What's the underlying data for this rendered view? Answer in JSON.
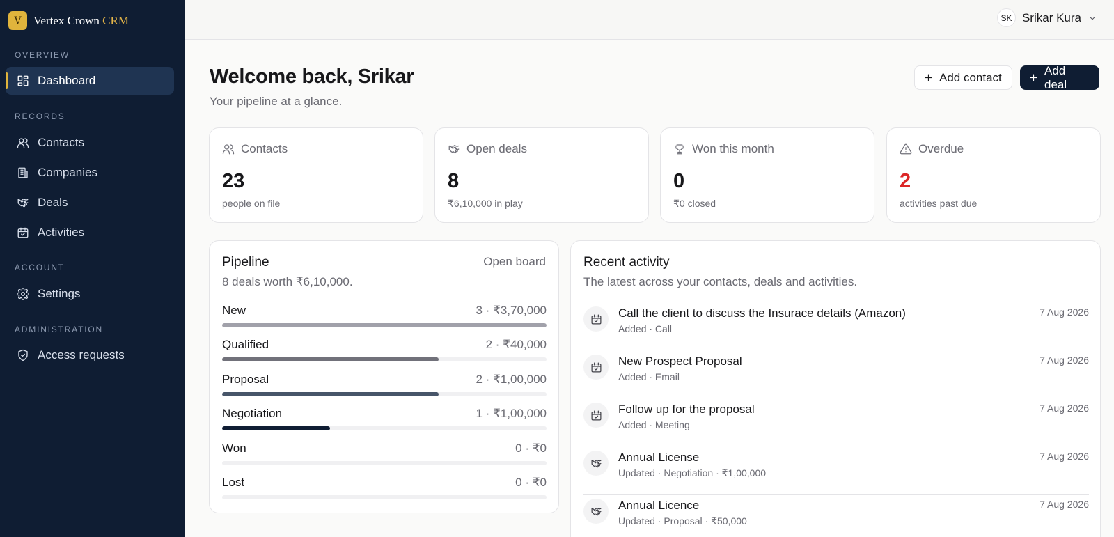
{
  "brand": {
    "logo_letter": "V",
    "name": "Vertex Crown",
    "accent": "CRM",
    "accent_color": "#e3b448"
  },
  "sidebar": {
    "sections": [
      {
        "label": "OVERVIEW",
        "items": [
          {
            "label": "Dashboard",
            "icon": "dashboard-icon",
            "active": true
          }
        ]
      },
      {
        "label": "RECORDS",
        "items": [
          {
            "label": "Contacts",
            "icon": "users-icon"
          },
          {
            "label": "Companies",
            "icon": "building-icon"
          },
          {
            "label": "Deals",
            "icon": "handshake-icon"
          },
          {
            "label": "Activities",
            "icon": "calendar-check-icon"
          }
        ]
      },
      {
        "label": "ACCOUNT",
        "items": [
          {
            "label": "Settings",
            "icon": "gear-icon"
          }
        ]
      },
      {
        "label": "ADMINISTRATION",
        "items": [
          {
            "label": "Access requests",
            "icon": "shield-check-icon"
          }
        ]
      }
    ]
  },
  "topbar": {
    "user_initials": "SK",
    "user_name": "Srikar Kura"
  },
  "header": {
    "title": "Welcome back, Srikar",
    "subtitle": "Your pipeline at a glance.",
    "add_contact_label": "Add contact",
    "add_deal_label": "Add deal"
  },
  "stats": [
    {
      "label": "Contacts",
      "value": "23",
      "sub": "people on file",
      "icon": "users-icon"
    },
    {
      "label": "Open deals",
      "value": "8",
      "sub": "₹6,10,000 in play",
      "icon": "handshake-icon"
    },
    {
      "label": "Won this month",
      "value": "0",
      "sub": "₹0 closed",
      "icon": "trophy-icon"
    },
    {
      "label": "Overdue",
      "value": "2",
      "sub": "activities past due",
      "icon": "alert-triangle-icon",
      "value_color": "#dc2626"
    }
  ],
  "pipeline": {
    "title": "Pipeline",
    "subtitle": "8 deals worth ₹6,10,000.",
    "link": "Open board",
    "stages": [
      {
        "name": "New",
        "meta": "3 · ₹3,70,000",
        "fill": 1.0,
        "color": "#a1a1aa"
      },
      {
        "name": "Qualified",
        "meta": "2 · ₹40,000",
        "fill": 0.667,
        "color": "#71717a"
      },
      {
        "name": "Proposal",
        "meta": "2 · ₹1,00,000",
        "fill": 0.667,
        "color": "#475569"
      },
      {
        "name": "Negotiation",
        "meta": "1 · ₹1,00,000",
        "fill": 0.333,
        "color": "#0f1d33"
      },
      {
        "name": "Won",
        "meta": "0 · ₹0",
        "fill": 0,
        "color": "#16a34a"
      },
      {
        "name": "Lost",
        "meta": "0 · ₹0",
        "fill": 0,
        "color": "#dc2626"
      }
    ]
  },
  "activity": {
    "title": "Recent activity",
    "subtitle": "The latest across your contacts, deals and activities.",
    "items": [
      {
        "title": "Call the client to discuss the Insurace details (Amazon)",
        "sub": "Added · Call",
        "date": "7 Aug 2026",
        "icon": "calendar-check-icon"
      },
      {
        "title": "New Prospect Proposal",
        "sub": "Added · Email",
        "date": "7 Aug 2026",
        "icon": "calendar-check-icon"
      },
      {
        "title": "Follow up for the proposal",
        "sub": "Added · Meeting",
        "date": "7 Aug 2026",
        "icon": "calendar-check-icon"
      },
      {
        "title": "Annual License",
        "sub": "Updated · Negotiation · ₹1,00,000",
        "date": "7 Aug 2026",
        "icon": "handshake-icon"
      },
      {
        "title": "Annual Licence",
        "sub": "Updated · Proposal · ₹50,000",
        "date": "7 Aug 2026",
        "icon": "handshake-icon"
      }
    ]
  }
}
